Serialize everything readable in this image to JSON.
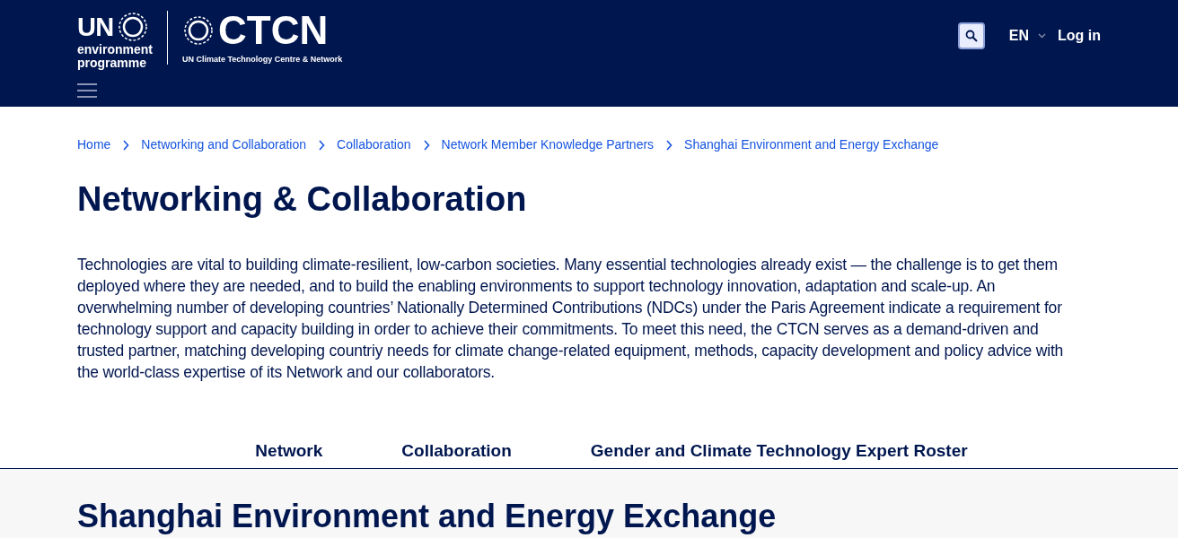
{
  "header": {
    "un_logo": {
      "title": "UN",
      "lines": [
        "environment",
        "programme"
      ]
    },
    "ctcn_logo": {
      "title": "CTCN",
      "subtitle": "UN Climate Technology Centre & Network"
    },
    "language": "EN",
    "login": "Log in"
  },
  "breadcrumb": [
    "Home",
    "Networking and Collaboration",
    "Collaboration",
    "Network Member Knowledge Partners",
    "Shanghai Environment and Energy Exchange"
  ],
  "title": "Networking & Collaboration",
  "intro": "Technologies are vital to building climate-resilient, low-carbon societies. Many essential technologies already exist — the challenge is to get them deployed where they are needed, and to build the enabling environments to support technology innovation, adaptation and scale-up. An overwhelming number of developing countries’ Nationally Determined Contributions (NDCs) under the Paris Agreement indicate a requirement for technology support and capacity building in order to achieve their commitments. To meet this need, the CTCN serves as a demand-driven and trusted partner, matching developing countriy needs for climate change-related equipment, methods, capacity development and policy advice with the world-class expertise of its Network and our collaborators.",
  "tabs": [
    "Network",
    "Collaboration",
    "Gender and Climate Technology Expert Roster"
  ],
  "section_title": "Shanghai Environment and Energy Exchange"
}
